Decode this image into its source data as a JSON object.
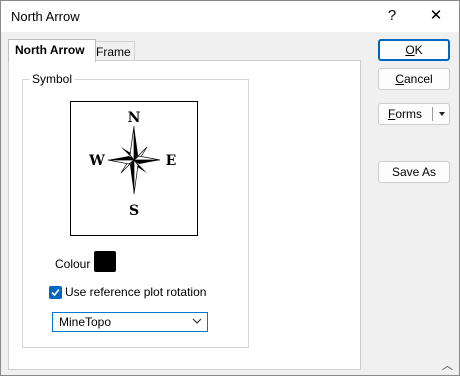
{
  "window": {
    "title": "North Arrow",
    "help_label": "?",
    "close_label": "✕"
  },
  "tabs": [
    {
      "label": "North Arrow",
      "active": true
    },
    {
      "label": "Frame",
      "active": false
    }
  ],
  "symbol_group": {
    "label": "Symbol",
    "compass": {
      "n": "N",
      "s": "S",
      "e": "E",
      "w": "W"
    },
    "colour_label": "Colour",
    "colour_value": "#000000",
    "checkbox": {
      "label": "Use reference plot rotation",
      "checked": true
    },
    "select": {
      "value": "MineTopo"
    }
  },
  "buttons": {
    "ok": "OK",
    "cancel": "Cancel",
    "forms": "Forms",
    "save_as": "Save As"
  },
  "colors": {
    "accent": "#0067c0"
  }
}
